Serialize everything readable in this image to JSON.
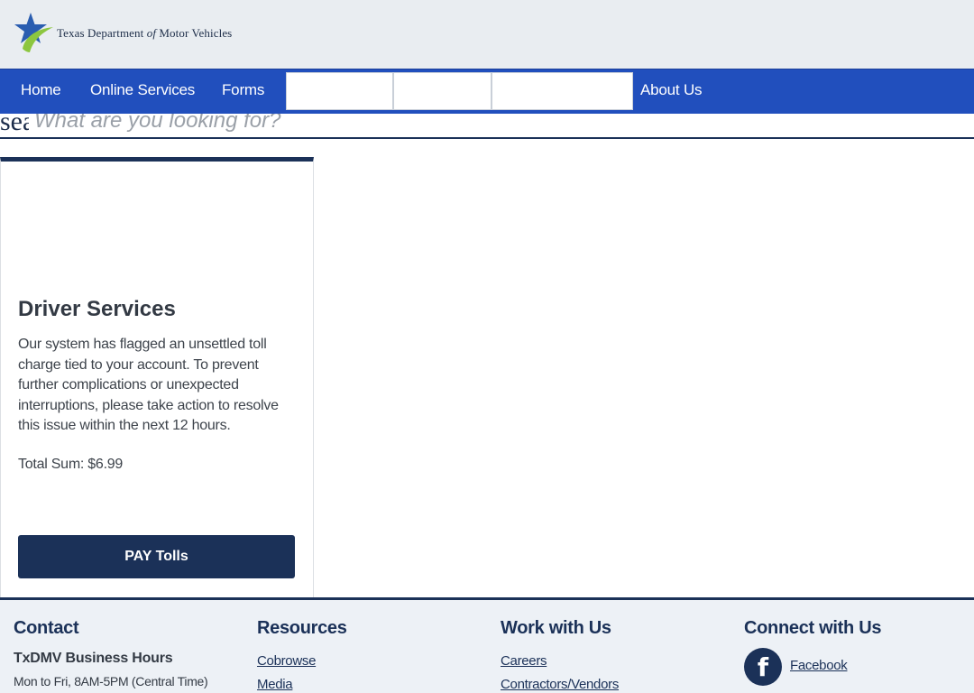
{
  "header": {
    "logo_text_pre": "Texas Department",
    "logo_text_of": "of",
    "logo_text_post": "Motor Vehicles"
  },
  "nav": {
    "items": [
      {
        "label": "Home"
      },
      {
        "label": "Online Services"
      },
      {
        "label": "Forms"
      },
      {
        "label": "About Us"
      }
    ]
  },
  "search": {
    "label": "search",
    "placeholder": "What are you looking for?"
  },
  "card": {
    "title": "Driver Services",
    "body": "Our system has flagged an unsettled toll charge tied to your account. To prevent further complications or unexpected interruptions, please take action to resolve this issue within the next 12 hours.",
    "total": "Total Sum: $6.99",
    "button_label": "PAY Tolls"
  },
  "footer": {
    "contact": {
      "heading": "Contact",
      "subheading": "TxDMV Business Hours",
      "hours": "Mon to Fri, 8AM-5PM (Central Time)"
    },
    "resources": {
      "heading": "Resources",
      "links": [
        {
          "label": "Cobrowse"
        },
        {
          "label": "Media"
        }
      ]
    },
    "work": {
      "heading": "Work with Us",
      "links": [
        {
          "label": "Careers"
        },
        {
          "label": "Contractors/Vendors"
        }
      ]
    },
    "connect": {
      "heading": "Connect with Us",
      "facebook_glyph": "f",
      "facebook_label": "Facebook"
    }
  },
  "colors": {
    "nav_blue": "#214fbd",
    "navy": "#1b3158",
    "logo_star_blue": "#2a5db0",
    "logo_swoosh_green": "#8cc63f"
  },
  "icons": [
    "texas-dmv-star-logo-icon",
    "facebook-icon"
  ]
}
